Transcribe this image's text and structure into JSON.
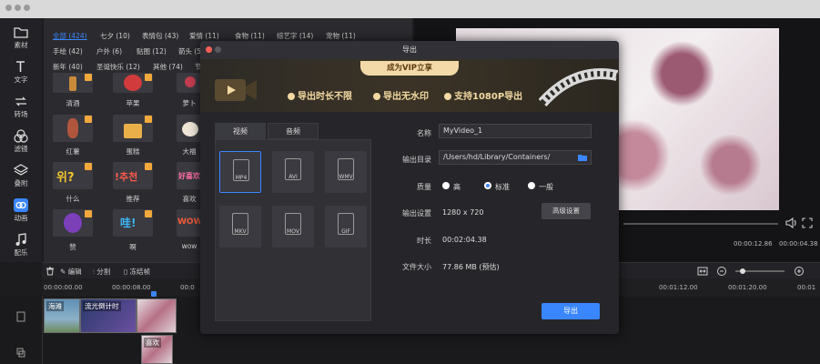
{
  "rail": {
    "items": [
      {
        "label": "素材"
      },
      {
        "label": "文字"
      },
      {
        "label": "转场"
      },
      {
        "label": "滤镜"
      },
      {
        "label": "叠附"
      },
      {
        "label": "动画"
      },
      {
        "label": "配乐"
      }
    ]
  },
  "categories": [
    {
      "label": "全部 (424)"
    },
    {
      "label": "七夕 (10)"
    },
    {
      "label": "表情包 (43)"
    },
    {
      "label": "爱情 (11)"
    },
    {
      "label": "食物 (11)"
    },
    {
      "label": "综艺字 (14)"
    },
    {
      "label": "宠物 (11)"
    },
    {
      "label": "手绘 (42)"
    },
    {
      "label": "户外 (6)"
    },
    {
      "label": "贴图 (12)"
    },
    {
      "label": "箭头 (5"
    },
    {
      "label": "新年 (40)"
    },
    {
      "label": "圣诞快乐 (12)"
    },
    {
      "label": "其他 (74)"
    },
    {
      "label": "节"
    }
  ],
  "stickers": [
    {
      "label": "清酒"
    },
    {
      "label": "苹果"
    },
    {
      "label": "萝卜"
    },
    {
      "label": "红薯"
    },
    {
      "label": "蛋糕"
    },
    {
      "label": "大福"
    },
    {
      "label": "什么"
    },
    {
      "label": "推荐"
    },
    {
      "label": "喜欢"
    },
    {
      "label": "赞"
    },
    {
      "label": "啊"
    },
    {
      "label": "wow"
    }
  ],
  "sticker_texts": {
    "what": "위?",
    "recommend": "!추천",
    "like": "好喜欢",
    "wa": "哇!",
    "wow": "WOW"
  },
  "preview": {
    "time_current": "00:00:12.86",
    "time_total": "00:00:04.38"
  },
  "toolbar": {
    "edit": "编辑",
    "split": "分割",
    "freeze": "冻结帧",
    "export": "导出"
  },
  "ruler": [
    "00:00:00.00",
    "00:00:08.00",
    "00:0",
    "00:01:12.00",
    "00:01:20.00",
    "00:01"
  ],
  "clips": [
    {
      "label": "海滩"
    },
    {
      "label": "流光倒计时"
    },
    {
      "label": "喜欢"
    }
  ],
  "dialog": {
    "title": "导出",
    "vip": "成为VIP立享",
    "perks": [
      "导出时长不限",
      "导出无水印",
      "支持1080P导出"
    ],
    "tabs": [
      "视频",
      "音频"
    ],
    "formats": [
      "MP4",
      "AVI",
      "WMV",
      "MKV",
      "MOV",
      "GIF"
    ],
    "name_label": "名称",
    "name_value": "MyVideo_1",
    "dir_label": "输出目录",
    "dir_value": "/Users/hd/Library/Containers/",
    "quality_label": "质量",
    "quality_options": [
      "高",
      "标准",
      "一般"
    ],
    "settings_label": "输出设置",
    "settings_value": "1280 x 720",
    "advanced_btn": "高级设置",
    "duration_label": "时长",
    "duration_value": "00:02:04.38",
    "size_label": "文件大小",
    "size_value": "77.86 MB (预估)",
    "export_btn": "导出"
  },
  "colors": {
    "accent": "#3a86ff",
    "vip_gold": "#f3d9a2",
    "badge": "#f2a93b"
  }
}
